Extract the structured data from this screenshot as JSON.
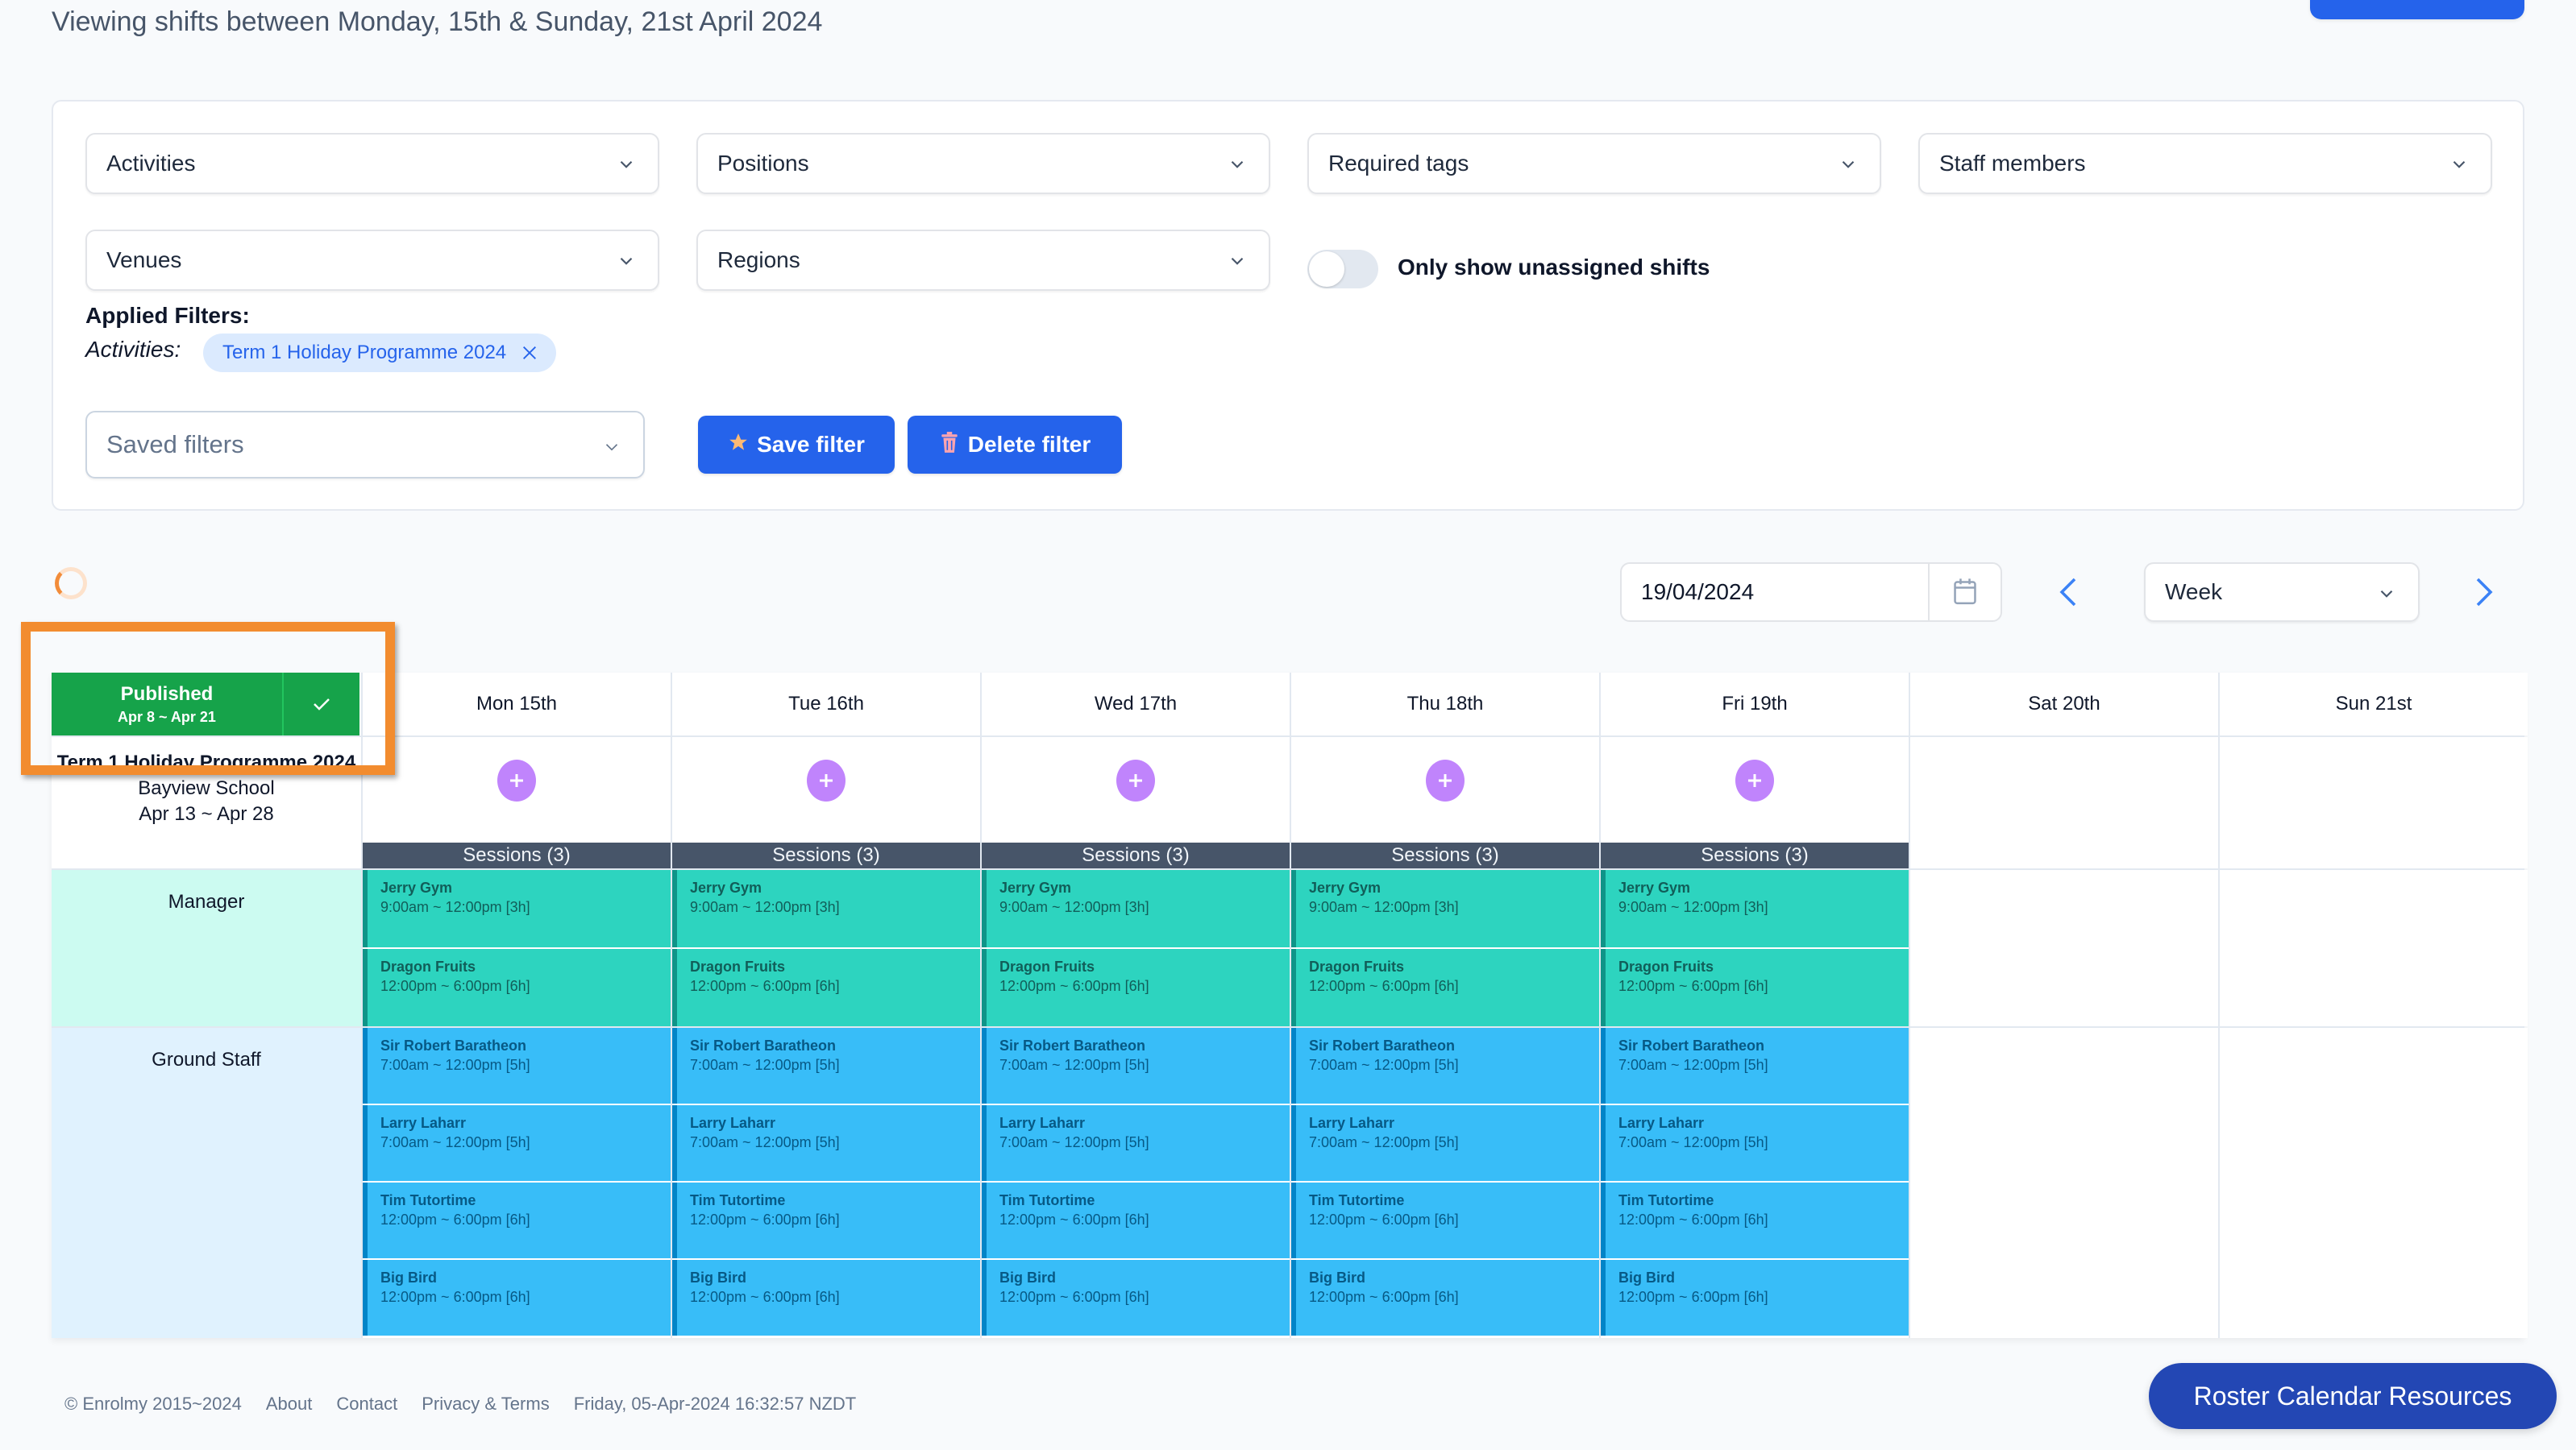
{
  "header": {
    "title": "Viewing shifts between Monday, 15th & Sunday, 21st April 2024"
  },
  "filters": {
    "dropdowns": [
      {
        "label": "Activities"
      },
      {
        "label": "Positions"
      },
      {
        "label": "Required tags"
      },
      {
        "label": "Staff members"
      },
      {
        "label": "Venues"
      },
      {
        "label": "Regions"
      }
    ],
    "unassigned_toggle": {
      "label": "Only show unassigned shifts",
      "checked": false
    },
    "applied": {
      "title": "Applied Filters:",
      "key": "Activities:",
      "chips": [
        {
          "label": "Term 1 Holiday Programme 2024",
          "icon": "close-icon"
        }
      ]
    },
    "saved_filters_placeholder": "Saved filters",
    "save_button": {
      "label": "Save filter",
      "icon": "star-icon"
    },
    "delete_button": {
      "label": "Delete filter",
      "icon": "trash-icon"
    }
  },
  "controls": {
    "date_value": "19/04/2024",
    "calendar_icon": "calendar-icon",
    "view_value": "Week",
    "prev_icon": "chevron-left-icon",
    "next_icon": "chevron-right-icon"
  },
  "calendar": {
    "status": {
      "label": "Published",
      "dates": "Apr 8 ~ Apr 21",
      "icon": "check-icon"
    },
    "activity": {
      "name": "Term 1 Holiday Programme 2024",
      "venue": "Bayview School",
      "dates": "Apr 13 ~ Apr 28"
    },
    "days": [
      {
        "label": "Mon 15th",
        "sessions": "Sessions (3)",
        "has_shifts": true
      },
      {
        "label": "Tue 16th",
        "sessions": "Sessions (3)",
        "has_shifts": true
      },
      {
        "label": "Wed 17th",
        "sessions": "Sessions (3)",
        "has_shifts": true
      },
      {
        "label": "Thu 18th",
        "sessions": "Sessions (3)",
        "has_shifts": true
      },
      {
        "label": "Fri 19th",
        "sessions": "Sessions (3)",
        "has_shifts": true
      },
      {
        "label": "Sat 20th",
        "sessions": "",
        "has_shifts": false
      },
      {
        "label": "Sun 21st",
        "sessions": "",
        "has_shifts": false
      }
    ],
    "roles": [
      {
        "label": "Manager",
        "color": "#2dd4bf",
        "shifts": [
          {
            "name": "Jerry Gym",
            "time": "9:00am ~ 12:00pm [3h]"
          },
          {
            "name": "Dragon Fruits",
            "time": "12:00pm ~ 6:00pm [6h]"
          }
        ]
      },
      {
        "label": "Ground Staff",
        "color": "#38bdf8",
        "shifts": [
          {
            "name": "Sir Robert Baratheon",
            "time": "7:00am ~ 12:00pm [5h]"
          },
          {
            "name": "Larry Laharr",
            "time": "7:00am ~ 12:00pm [5h]"
          },
          {
            "name": "Tim Tutortime",
            "time": "12:00pm ~ 6:00pm [6h]"
          },
          {
            "name": "Big Bird",
            "time": "12:00pm ~ 6:00pm [6h]"
          }
        ]
      }
    ]
  },
  "footer": {
    "copyright": "© Enrolmy  2015~2024",
    "links": [
      "About",
      "Contact",
      "Privacy & Terms"
    ],
    "timestamp": "Friday, 05-Apr-2024 16:32:57 NZDT"
  },
  "roster_button": "Roster Calendar Resources"
}
